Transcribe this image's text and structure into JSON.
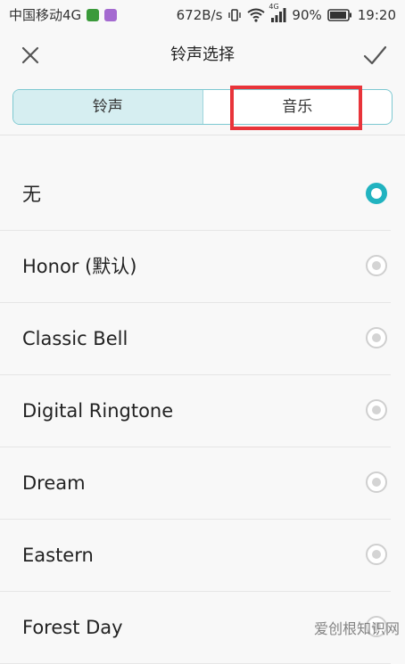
{
  "status_bar": {
    "carrier": "中国移动4G",
    "speed": "672B/s",
    "network": "4G",
    "battery": "90%",
    "time": "19:20"
  },
  "toolbar": {
    "title": "铃声选择",
    "close_icon": "close-icon",
    "confirm_icon": "checkmark-icon"
  },
  "tabs": [
    {
      "label": "铃声",
      "active": true
    },
    {
      "label": "音乐",
      "active": false
    }
  ],
  "ringtones": [
    {
      "label": "无",
      "selected": true
    },
    {
      "label": "Honor (默认)",
      "selected": false
    },
    {
      "label": "Classic Bell",
      "selected": false
    },
    {
      "label": "Digital Ringtone",
      "selected": false
    },
    {
      "label": "Dream",
      "selected": false
    },
    {
      "label": "Eastern",
      "selected": false
    },
    {
      "label": "Forest Day",
      "selected": false
    }
  ],
  "watermark": "爱创根知识网",
  "colors": {
    "accent": "#21b3c0",
    "highlight_box": "#e8343a",
    "active_tab_bg": "#d6eef1"
  }
}
